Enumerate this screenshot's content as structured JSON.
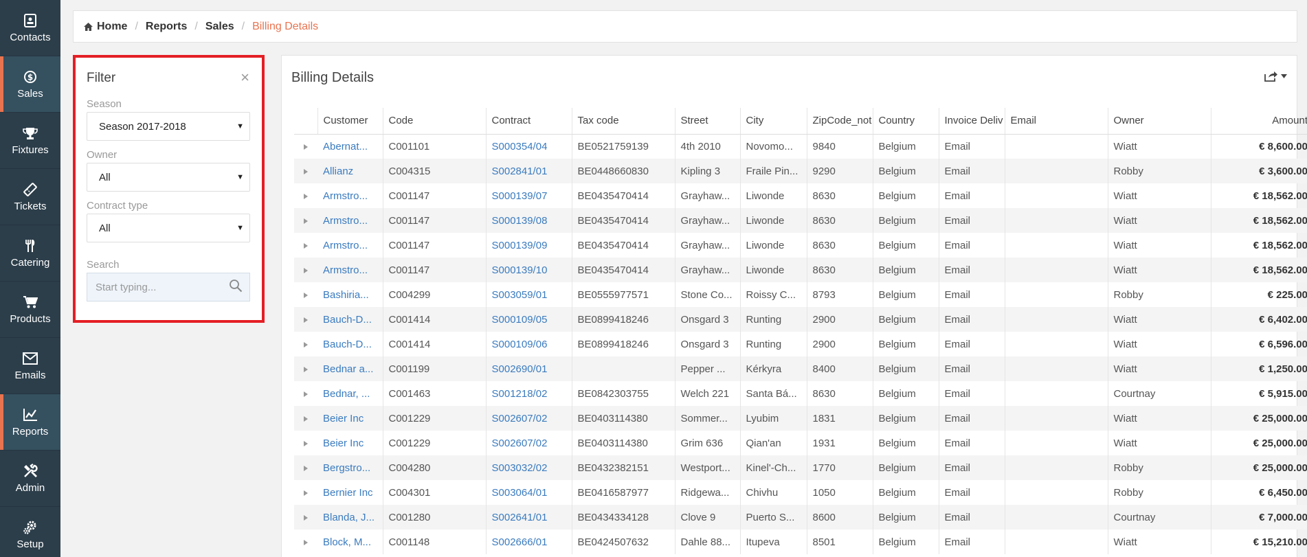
{
  "sidebar": {
    "items": [
      {
        "label": "Contacts",
        "icon": "contacts-icon"
      },
      {
        "label": "Sales",
        "icon": "dollar-icon"
      },
      {
        "label": "Fixtures",
        "icon": "trophy-icon"
      },
      {
        "label": "Tickets",
        "icon": "ticket-icon"
      },
      {
        "label": "Catering",
        "icon": "cutlery-icon"
      },
      {
        "label": "Products",
        "icon": "cart-icon"
      },
      {
        "label": "Emails",
        "icon": "mail-icon"
      },
      {
        "label": "Reports",
        "icon": "chart-icon"
      },
      {
        "label": "Admin",
        "icon": "tools-icon"
      },
      {
        "label": "Setup",
        "icon": "gears-icon"
      }
    ]
  },
  "breadcrumb": {
    "items": [
      "Home",
      "Reports",
      "Sales",
      "Billing Details"
    ]
  },
  "filter": {
    "title": "Filter",
    "close": "×",
    "season_label": "Season",
    "season_value": "Season 2017-2018",
    "owner_label": "Owner",
    "owner_value": "All",
    "contract_type_label": "Contract type",
    "contract_type_value": "All",
    "search_label": "Search",
    "search_placeholder": "Start typing..."
  },
  "card": {
    "title": "Billing Details"
  },
  "table": {
    "columns": [
      "Customer",
      "Code",
      "Contract",
      "Tax code",
      "Street",
      "City",
      "ZipCode_not",
      "Country",
      "Invoice Deliv",
      "Email",
      "Owner",
      "Amount"
    ],
    "rows": [
      [
        "Abernat...",
        "C001101",
        "S000354/04",
        "BE0521759139",
        "4th 2010",
        "Novomo...",
        "9840",
        "Belgium",
        "Email",
        "",
        "Wiatt",
        "€ 8,600.00"
      ],
      [
        "Allianz",
        "C004315",
        "S002841/01",
        "BE0448660830",
        "Kipling 3",
        "Fraile Pin...",
        "9290",
        "Belgium",
        "Email",
        "",
        "Robby",
        "€ 3,600.00"
      ],
      [
        "Armstro...",
        "C001147",
        "S000139/07",
        "BE0435470414",
        "Grayhaw...",
        "Liwonde",
        "8630",
        "Belgium",
        "Email",
        "",
        "Wiatt",
        "€ 18,562.00"
      ],
      [
        "Armstro...",
        "C001147",
        "S000139/08",
        "BE0435470414",
        "Grayhaw...",
        "Liwonde",
        "8630",
        "Belgium",
        "Email",
        "",
        "Wiatt",
        "€ 18,562.00"
      ],
      [
        "Armstro...",
        "C001147",
        "S000139/09",
        "BE0435470414",
        "Grayhaw...",
        "Liwonde",
        "8630",
        "Belgium",
        "Email",
        "",
        "Wiatt",
        "€ 18,562.00"
      ],
      [
        "Armstro...",
        "C001147",
        "S000139/10",
        "BE0435470414",
        "Grayhaw...",
        "Liwonde",
        "8630",
        "Belgium",
        "Email",
        "",
        "Wiatt",
        "€ 18,562.00"
      ],
      [
        "Bashiria...",
        "C004299",
        "S003059/01",
        "BE0555977571",
        "Stone Co...",
        "Roissy C...",
        "8793",
        "Belgium",
        "Email",
        "",
        "Robby",
        "€ 225.00"
      ],
      [
        "Bauch-D...",
        "C001414",
        "S000109/05",
        "BE0899418246",
        "Onsgard 3",
        "Runting",
        "2900",
        "Belgium",
        "Email",
        "",
        "Wiatt",
        "€ 6,402.00"
      ],
      [
        "Bauch-D...",
        "C001414",
        "S000109/06",
        "BE0899418246",
        "Onsgard 3",
        "Runting",
        "2900",
        "Belgium",
        "Email",
        "",
        "Wiatt",
        "€ 6,596.00"
      ],
      [
        "Bednar a...",
        "C001199",
        "S002690/01",
        "",
        "Pepper ...",
        "Kérkyra",
        "8400",
        "Belgium",
        "Email",
        "",
        "Wiatt",
        "€ 1,250.00"
      ],
      [
        "Bednar, ...",
        "C001463",
        "S001218/02",
        "BE0842303755",
        "Welch 221",
        "Santa Bá...",
        "8630",
        "Belgium",
        "Email",
        "",
        "Courtnay",
        "€ 5,915.00"
      ],
      [
        "Beier Inc",
        "C001229",
        "S002607/02",
        "BE0403114380",
        "Sommer...",
        "Lyubim",
        "1831",
        "Belgium",
        "Email",
        "",
        "Wiatt",
        "€ 25,000.00"
      ],
      [
        "Beier Inc",
        "C001229",
        "S002607/02",
        "BE0403114380",
        "Grim 636",
        "Qian'an",
        "1931",
        "Belgium",
        "Email",
        "",
        "Wiatt",
        "€ 25,000.00"
      ],
      [
        "Bergstro...",
        "C004280",
        "S003032/02",
        "BE0432382151",
        "Westport...",
        "Kinel'-Ch...",
        "1770",
        "Belgium",
        "Email",
        "",
        "Robby",
        "€ 25,000.00"
      ],
      [
        "Bernier Inc",
        "C004301",
        "S003064/01",
        "BE0416587977",
        "Ridgewa...",
        "Chivhu",
        "1050",
        "Belgium",
        "Email",
        "",
        "Robby",
        "€ 6,450.00"
      ],
      [
        "Blanda, J...",
        "C001280",
        "S002641/01",
        "BE0434334128",
        "Clove 9",
        "Puerto S...",
        "8600",
        "Belgium",
        "Email",
        "",
        "Courtnay",
        "€ 7,000.00"
      ],
      [
        "Block, M...",
        "C001148",
        "S002666/01",
        "BE0424507632",
        "Dahle 88...",
        "Itupeva",
        "8501",
        "Belgium",
        "Email",
        "",
        "Wiatt",
        "€ 15,210.00"
      ]
    ]
  },
  "colors": {
    "sidebar_bg": "#2c3e4a",
    "accent": "#e8734f",
    "link": "#3a7bbf",
    "highlight_border": "#e41f25"
  }
}
